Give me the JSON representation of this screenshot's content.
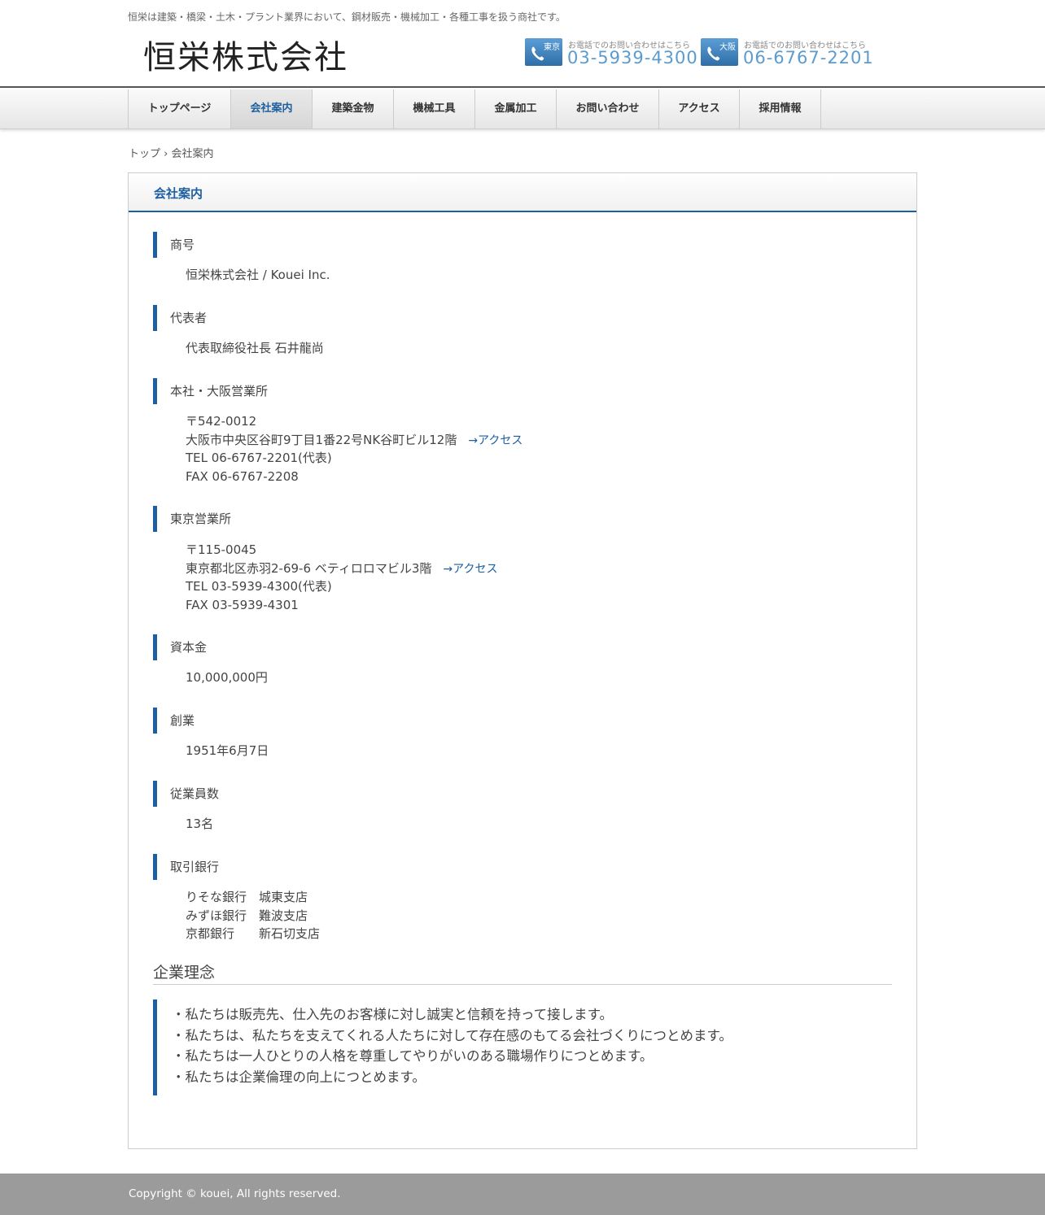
{
  "header": {
    "tagline": "恒栄は建築・橋梁・土木・プラント業界において、鋼材販売・機械加工・各種工事を扱う商社です。",
    "logo": "恒栄株式会社",
    "contacts": [
      {
        "city": "東京",
        "label": "お電話でのお問い合わせはこちら",
        "phone": "03-5939-4300"
      },
      {
        "city": "大阪",
        "label": "お電話でのお問い合わせはこちら",
        "phone": "06-6767-2201"
      }
    ]
  },
  "nav": {
    "items": [
      {
        "label": "トップページ"
      },
      {
        "label": "会社案内"
      },
      {
        "label": "建築金物"
      },
      {
        "label": "機械工具"
      },
      {
        "label": "金属加工"
      },
      {
        "label": "お問い合わせ"
      },
      {
        "label": "アクセス"
      },
      {
        "label": "採用情報"
      }
    ],
    "active": "会社案内"
  },
  "breadcrumb": {
    "home": "トップ",
    "separator": "›",
    "current": "会社案内"
  },
  "page": {
    "title": "会社案内",
    "sections": [
      {
        "heading": "商号",
        "lines": [
          "恒栄株式会社 / Kouei Inc."
        ]
      },
      {
        "heading": "代表者",
        "lines": [
          "代表取締役社長 石井龍尚"
        ]
      },
      {
        "heading": "本社・大阪営業所",
        "lines": [
          "〒542-0012",
          "大阪市中央区谷町9丁目1番22号NK谷町ビル12階",
          "TEL 06-6767-2201(代表)",
          "FAX 06-6767-2208"
        ],
        "link": "→アクセス"
      },
      {
        "heading": "東京営業所",
        "lines": [
          "〒115-0045",
          "東京都北区赤羽2-69-6 ベティロロマビル3階",
          "TEL 03-5939-4300(代表)",
          "FAX 03-5939-4301"
        ],
        "link": "→アクセス"
      },
      {
        "heading": "資本金",
        "lines": [
          "10,000,000円"
        ]
      },
      {
        "heading": "創業",
        "lines": [
          "1951年6月7日"
        ]
      },
      {
        "heading": "従業員数",
        "lines": [
          "13名"
        ]
      },
      {
        "heading": "取引銀行",
        "lines": [
          "りそな銀行　城東支店",
          "みずほ銀行　難波支店",
          "京都銀行　　新石切支店"
        ]
      }
    ],
    "philosophy": {
      "title": "企業理念",
      "lines": [
        "・私たちは販売先、仕入先のお客様に対し誠実と信頼を持って接します。",
        "・私たちは、私たちを支えてくれる人たちに対して存在感のもてる会社づくりにつとめます。",
        "・私たちは一人ひとりの人格を尊重してやりがいのある職場作りにつとめます。",
        "・私たちは企業倫理の向上につとめます。"
      ]
    }
  },
  "footer": {
    "copyright": "Copyright © kouei, All rights reserved."
  },
  "colors": {
    "accent": "#1d5fa0",
    "phone": "#5a9bd0",
    "footer": "#9b9b9b"
  }
}
